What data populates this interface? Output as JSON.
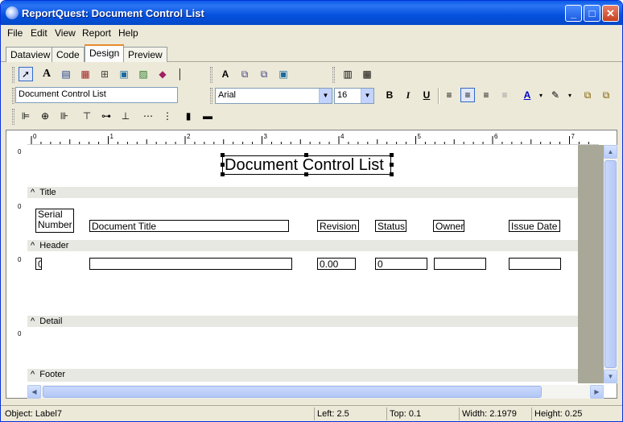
{
  "window": {
    "title": "ReportQuest: Document Control List"
  },
  "menu": [
    "File",
    "Edit",
    "View",
    "Report",
    "Help"
  ],
  "tabs": [
    "Dataview",
    "Code",
    "Design",
    "Preview"
  ],
  "active_tab": "Design",
  "toolbar": {
    "object_name": "Document Control List",
    "font_name": "Arial",
    "font_size": "16"
  },
  "report": {
    "title_label": "Document Control List",
    "bands": [
      "Title",
      "Header",
      "Detail",
      "Footer"
    ],
    "header_labels": {
      "serial_line1": "Serial",
      "serial_line2": "Number",
      "doc_title": "Document Title",
      "revision": "Revision",
      "status": "Status",
      "owner": "Owner",
      "issue_date": "Issue Date"
    },
    "detail_fields": {
      "serial": "0",
      "revision": "0.00",
      "status": "0"
    },
    "ruler_labels": [
      "0",
      "1",
      "2",
      "3",
      "4",
      "5",
      "6",
      "7"
    ],
    "side_ruler_zero": "0"
  },
  "status": {
    "object": "Object: Label7",
    "left": "Left: 2.5",
    "top": "Top: 0.1",
    "width": "Width: 2.1979",
    "height": "Height: 0.25"
  },
  "colors": {
    "accent": "#e68b2c",
    "titlebar": "#0451de"
  }
}
